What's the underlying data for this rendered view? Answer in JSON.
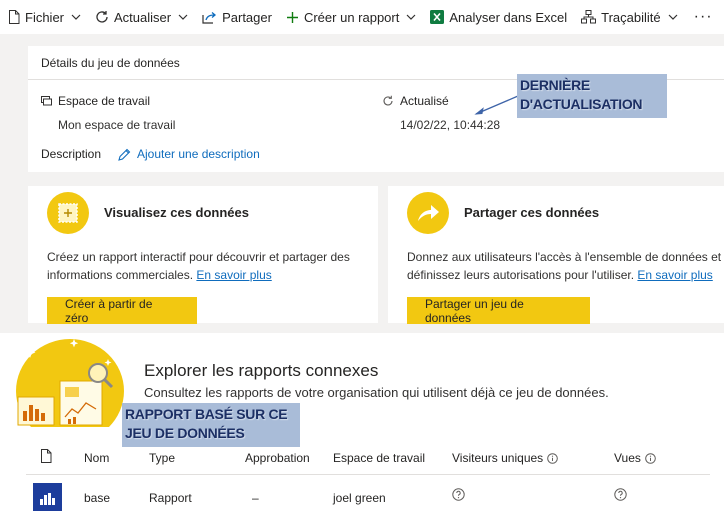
{
  "toolbar": {
    "file": "Fichier",
    "refresh": "Actualiser",
    "share": "Partager",
    "create_report": "Créer un rapport",
    "analyze_excel": "Analyser dans Excel",
    "lineage": "Traçabilité",
    "more": "···"
  },
  "details": {
    "title": "Détails du jeu de données",
    "workspace_label": "Espace de travail",
    "workspace_value": "Mon espace de travail",
    "updated_label": "Actualisé",
    "updated_value": "14/02/22, 10:44:28",
    "description_label": "Description",
    "add_description": "Ajouter une description"
  },
  "annotations": {
    "last_refresh": "DERNIÈRE D'ACTUALISATION",
    "report_based": "RAPPORT BASÉ SUR CE JEU DE DONNÉES"
  },
  "visualize": {
    "title": "Visualisez ces données",
    "text": "Créez un rapport interactif pour découvrir et partager des informations commerciales.",
    "link": "En savoir plus",
    "button": "Créer à partir de zéro"
  },
  "share_card": {
    "title": "Partager ces données",
    "text": "Donnez aux utilisateurs l'accès à l'ensemble de données et définissez leurs autorisations pour l'utiliser.",
    "link": "En savoir plus",
    "button": "Partager un jeu de données"
  },
  "explore": {
    "title": "Explorer les rapports connexes",
    "subtitle": "Consultez les rapports de votre organisation qui utilisent déjà ce jeu de données.",
    "columns": {
      "name": "Nom",
      "type": "Type",
      "approval": "Approbation",
      "workspace": "Espace de travail",
      "unique_visitors": "Visiteurs uniques",
      "views": "Vues"
    },
    "rows": [
      {
        "name": "base",
        "type": "Rapport",
        "approval": "–",
        "workspace": "joel green"
      }
    ]
  },
  "colors": {
    "accent_yellow": "#f2c811",
    "link_blue": "#0f6cbd",
    "report_icon_blue": "#1d3d9c",
    "annotation_bg": "#a9bcd8",
    "annotation_text": "#1c2f64"
  }
}
